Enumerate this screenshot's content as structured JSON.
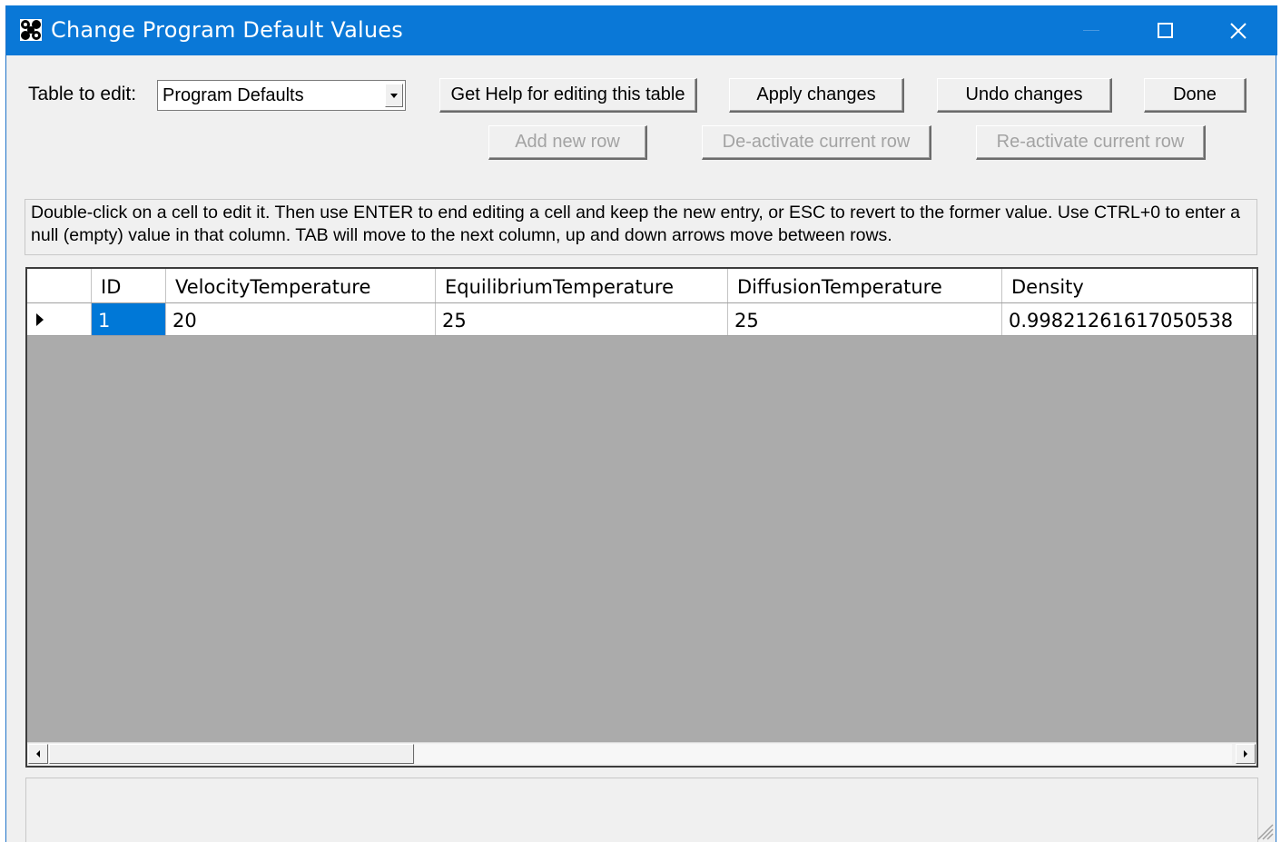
{
  "window": {
    "title": "Change Program Default Values",
    "icon": "app-icon"
  },
  "toolbar": {
    "table_label": "Table to edit:",
    "table_select_value": "Program Defaults",
    "help_button": "Get Help for editing this table",
    "apply_button": "Apply changes",
    "undo_button": "Undo changes",
    "done_button": "Done",
    "add_row_button": "Add new row",
    "deactivate_button": "De-activate current row",
    "reactivate_button": "Re-activate current row"
  },
  "help_text": "Double-click on a cell to edit it. Then use ENTER to end editing a cell and keep the new entry, or ESC to revert to the former value. Use CTRL+0 to enter a null (empty) value in that column. TAB will move to the next column, up and down arrows move between rows.",
  "grid": {
    "columns": [
      "ID",
      "VelocityTemperature",
      "EquilibriumTemperature",
      "DiffusionTemperature",
      "Density"
    ],
    "rows": [
      [
        "1",
        "20",
        "25",
        "25",
        "0.99821261617050538"
      ]
    ],
    "selected_cell": "ID"
  },
  "colors": {
    "titlebar": "#0a78d7",
    "selection": "#0078d7",
    "grid_background": "#ababab"
  }
}
